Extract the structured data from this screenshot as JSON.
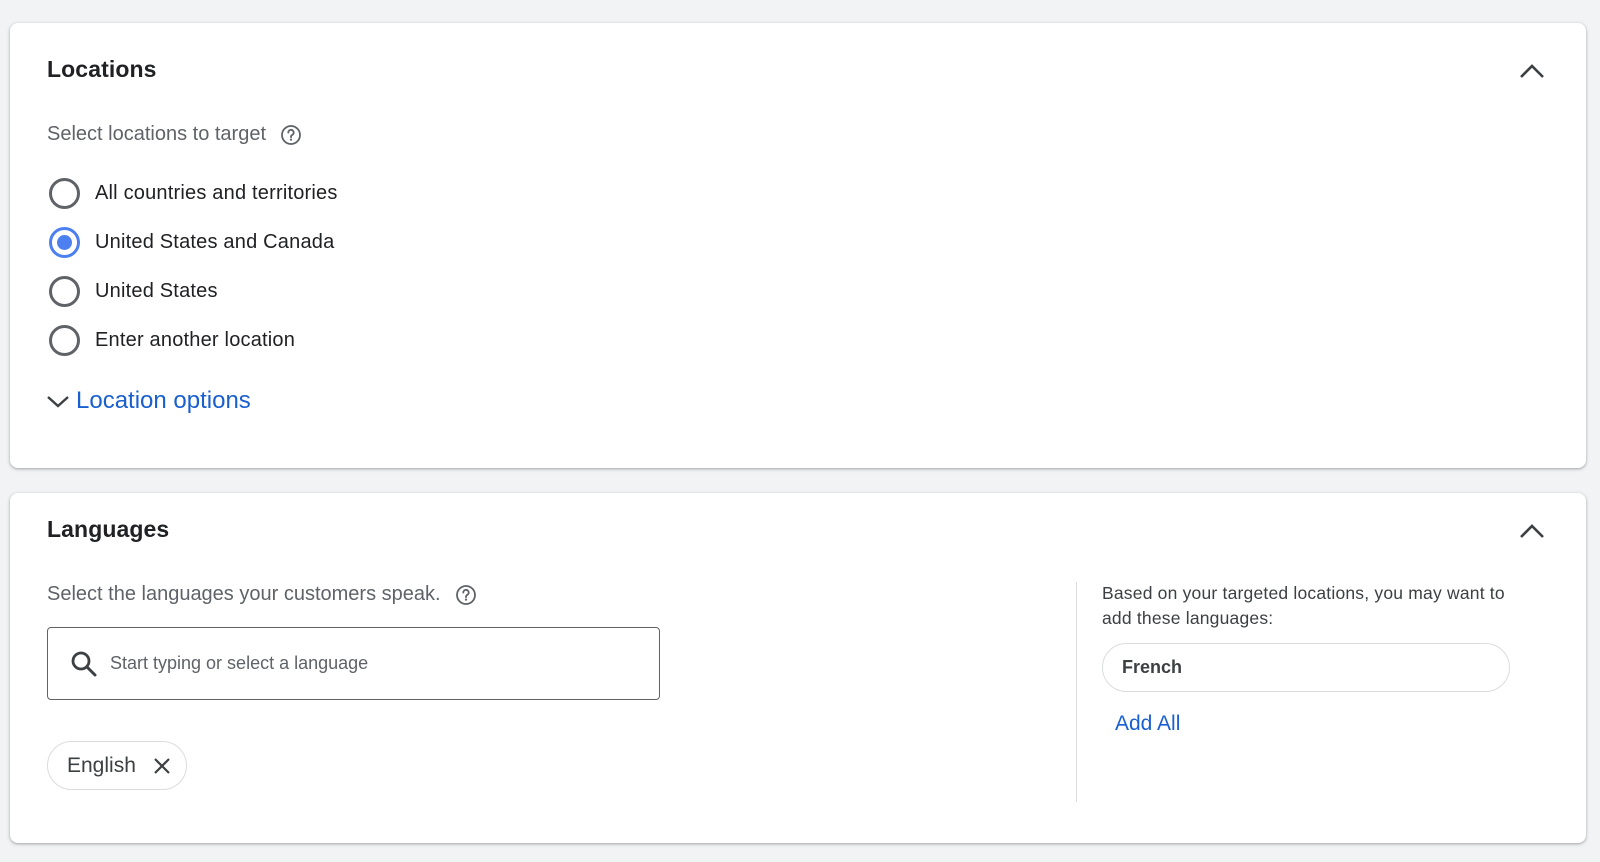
{
  "locations": {
    "title": "Locations",
    "collapse_icon": "chevron-up-icon",
    "subtitle": "Select locations to target",
    "help_icon": "help-circle-icon",
    "options": [
      {
        "label": "All countries and territories",
        "selected": false
      },
      {
        "label": "United States and Canada",
        "selected": true
      },
      {
        "label": "United States",
        "selected": false
      },
      {
        "label": "Enter another location",
        "selected": false
      }
    ],
    "location_options_label": "Location options",
    "location_options_icon": "chevron-down-icon"
  },
  "languages": {
    "title": "Languages",
    "collapse_icon": "chevron-up-icon",
    "subtitle": "Select the languages your customers speak.",
    "help_icon": "help-circle-icon",
    "search": {
      "placeholder": "Start typing or select a language",
      "value": "",
      "icon": "search-icon"
    },
    "selected": [
      {
        "label": "English",
        "remove_icon": "close-icon"
      }
    ],
    "suggestions": {
      "text": "Based on your targeted locations, you may want to add these languages:",
      "items": [
        {
          "label": "French"
        }
      ],
      "add_all_label": "Add All"
    }
  },
  "colors": {
    "accent": "#4c7ff0",
    "link": "#1a5fd0",
    "background": "#f1f3f4"
  }
}
